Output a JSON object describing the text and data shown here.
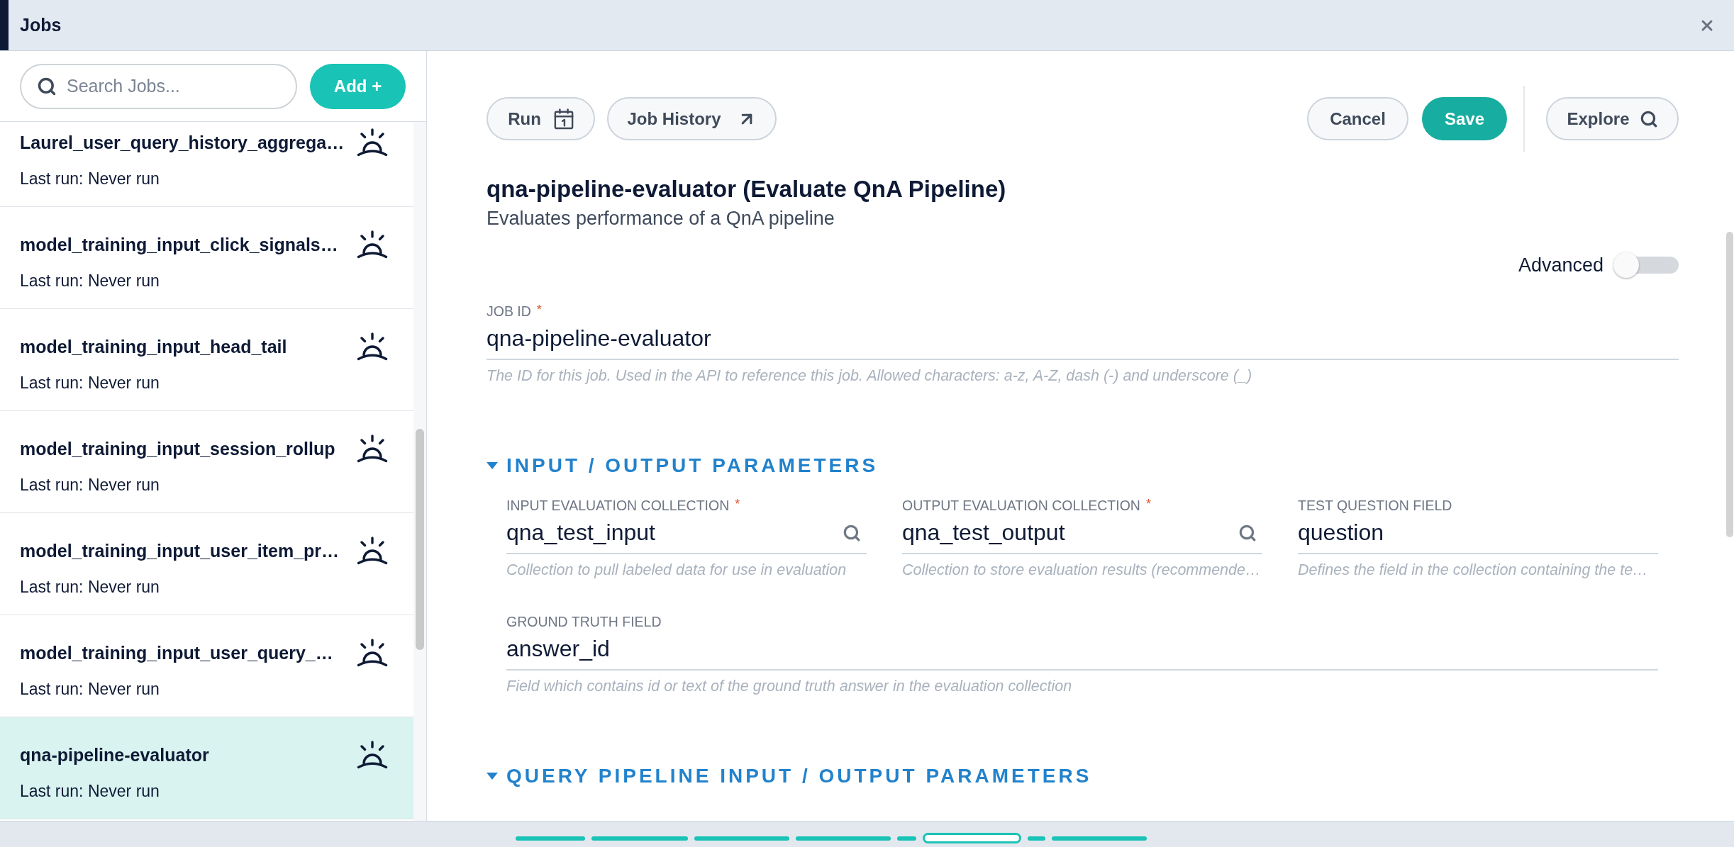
{
  "window": {
    "title": "Jobs"
  },
  "sidebar": {
    "search": {
      "placeholder": "Search Jobs..."
    },
    "add_button": "Add +",
    "jobs": [
      {
        "name": "Laurel_user_query_history_aggrega…",
        "last_run": "Last run: Never run",
        "selected": false
      },
      {
        "name": "model_training_input_click_signals…",
        "last_run": "Last run: Never run",
        "selected": false
      },
      {
        "name": "model_training_input_head_tail",
        "last_run": "Last run: Never run",
        "selected": false
      },
      {
        "name": "model_training_input_session_rollup",
        "last_run": "Last run: Never run",
        "selected": false
      },
      {
        "name": "model_training_input_user_item_pr…",
        "last_run": "Last run: Never run",
        "selected": false
      },
      {
        "name": "model_training_input_user_query_…",
        "last_run": "Last run: Never run",
        "selected": false
      },
      {
        "name": "qna-pipeline-evaluator",
        "last_run": "Last run: Never run",
        "selected": true
      }
    ]
  },
  "toolbar": {
    "run": "Run",
    "job_history": "Job History",
    "cancel": "Cancel",
    "save": "Save",
    "explore": "Explore"
  },
  "job": {
    "title": "qna-pipeline-evaluator (Evaluate QnA Pipeline)",
    "description": "Evaluates performance of a QnA pipeline"
  },
  "advanced": {
    "label": "Advanced",
    "on": false
  },
  "job_id": {
    "label": "JOB ID",
    "required_mark": "*",
    "value": "qna-pipeline-evaluator",
    "help": "The ID for this job. Used in the API to reference this job. Allowed characters: a-z, A-Z, dash (-) and underscore (_)"
  },
  "sections": [
    {
      "title": "INPUT / OUTPUT PARAMETERS",
      "expanded": true,
      "rows": [
        {
          "fields": [
            {
              "kind": "lookup",
              "label": "INPUT EVALUATION COLLECTION",
              "required_mark": "*",
              "value": "qna_test_input",
              "help": "Collection to pull labeled data for use in evaluation"
            },
            {
              "kind": "lookup",
              "label": "OUTPUT EVALUATION COLLECTION",
              "required_mark": "*",
              "value": "qna_test_output",
              "help": "Collection to store evaluation results (recommende…"
            },
            {
              "kind": "text",
              "label": "TEST QUESTION FIELD",
              "value": "question",
              "help": "Defines the field in the collection containing the te…"
            }
          ]
        },
        {
          "fields": [
            {
              "kind": "text",
              "label": "GROUND TRUTH FIELD",
              "value": "answer_id",
              "help": "Field which contains id or text of the ground truth answer in the evaluation collection"
            }
          ]
        }
      ]
    },
    {
      "title": "QUERY PIPELINE INPUT / OUTPUT PARAMETERS",
      "expanded": true
    }
  ],
  "page_indicator": {
    "segments": [
      {
        "selected": false
      },
      {
        "selected": false
      },
      {
        "selected": false
      },
      {
        "selected": false
      },
      {
        "selected": false
      },
      {
        "selected": true
      },
      {
        "selected": false
      },
      {
        "selected": false
      }
    ]
  }
}
